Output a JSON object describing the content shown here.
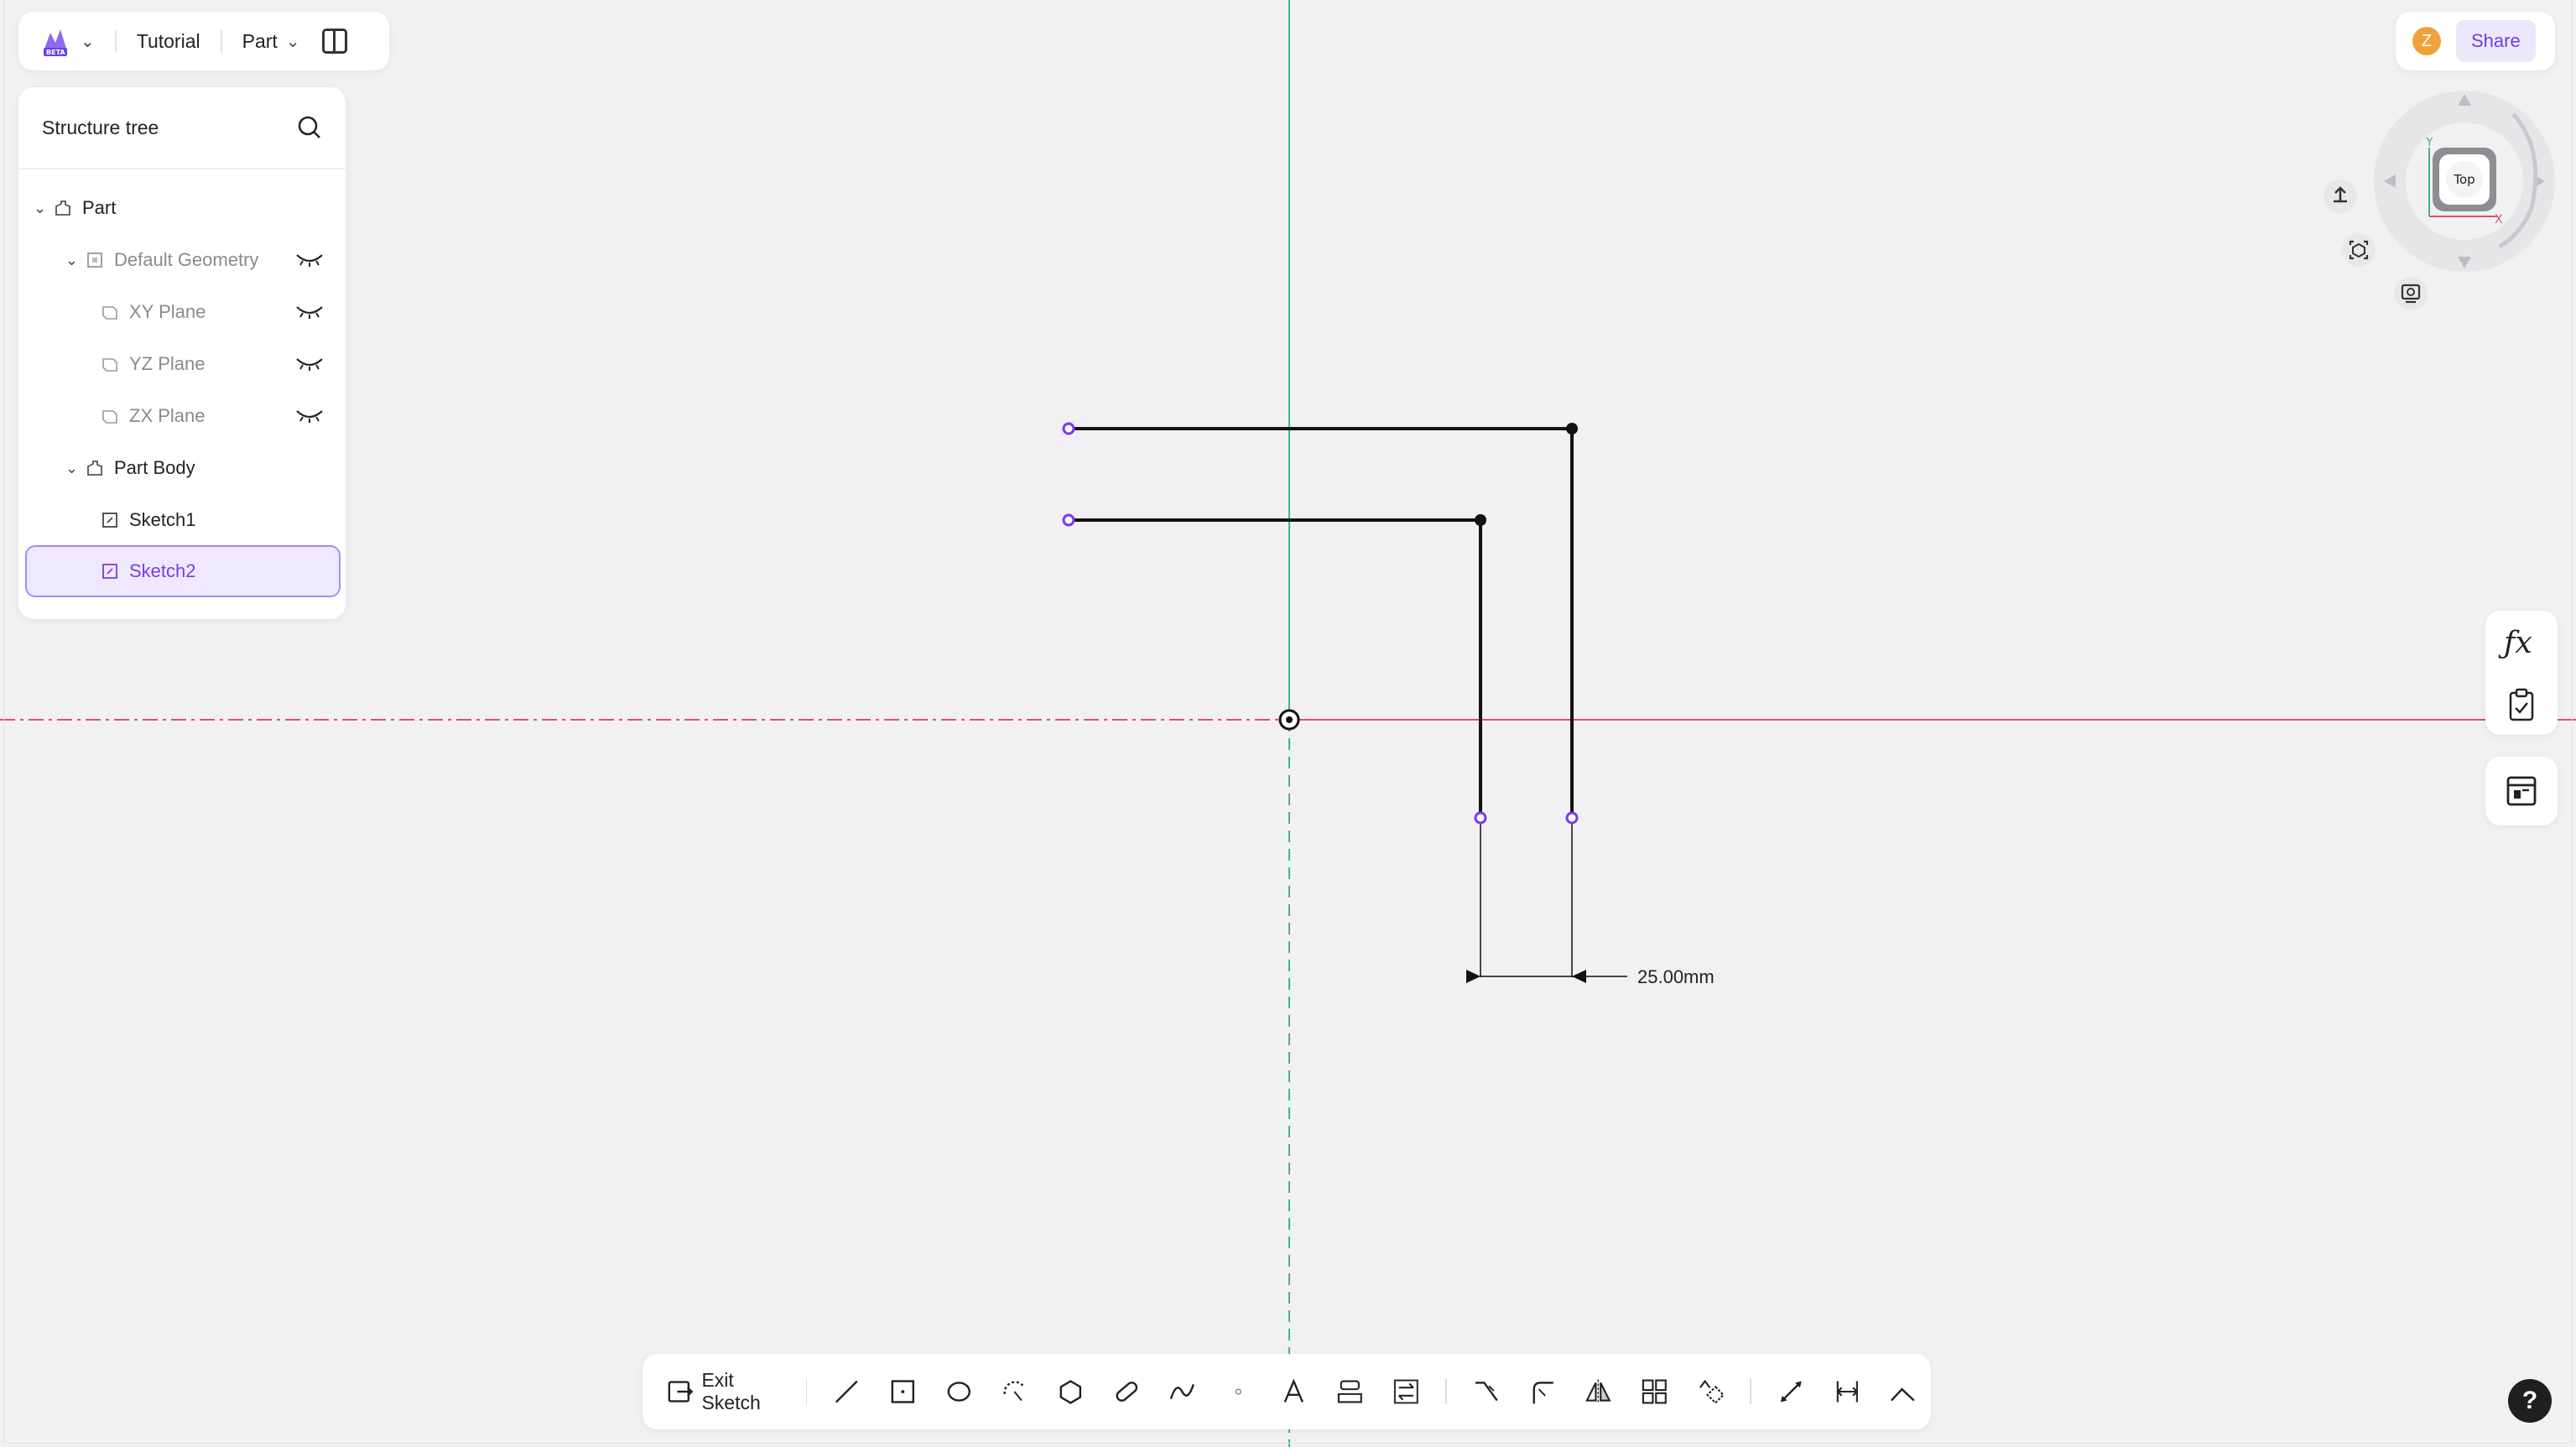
{
  "header": {
    "project_name": "Tutorial",
    "mode_label": "Part"
  },
  "tree": {
    "title": "Structure tree",
    "items": [
      {
        "label": "Part"
      },
      {
        "label": "Default Geometry"
      },
      {
        "label": "XY Plane"
      },
      {
        "label": "YZ Plane"
      },
      {
        "label": "ZX Plane"
      },
      {
        "label": "Part Body"
      },
      {
        "label": "Sketch1"
      },
      {
        "label": "Sketch2"
      }
    ]
  },
  "topright": {
    "avatar_initial": "Z",
    "share_label": "Share"
  },
  "viewcube": {
    "face_label": "Top",
    "axis_x": "X",
    "axis_y": "Y"
  },
  "sketch": {
    "dimension_label": "25.00mm"
  },
  "toolbar": {
    "exit_label": "Exit Sketch",
    "tools": [
      "line-icon",
      "rectangle-icon",
      "circle-icon",
      "arc-icon",
      "polygon-icon",
      "slot-icon",
      "spline-icon",
      "point-icon",
      "text-icon",
      "offset-icon",
      "transfer-icon",
      "trim-icon",
      "fillet-icon",
      "mirror-icon",
      "pattern-icon",
      "transform-icon",
      "dimension-icon",
      "constraint-icon",
      "measure-icon"
    ]
  },
  "colors": {
    "accent": "#7c3aed",
    "x_axis": "#e0506a",
    "y_axis": "#3fb58a"
  }
}
